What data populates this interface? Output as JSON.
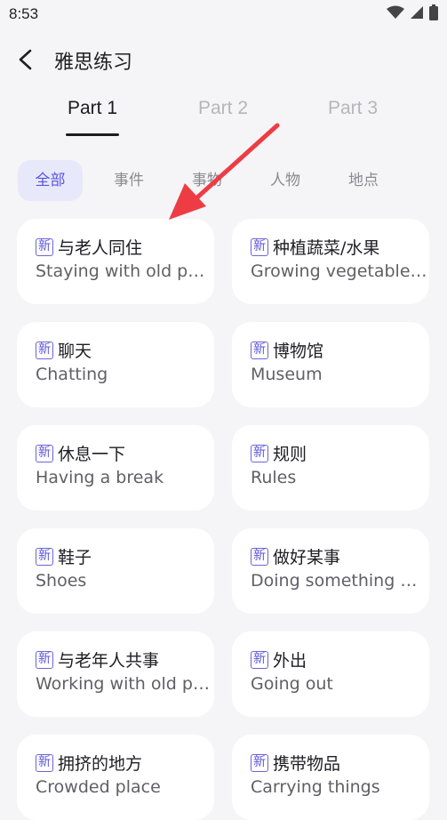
{
  "status_bar": {
    "time": "8:53"
  },
  "header": {
    "title": "雅思练习"
  },
  "tabs": [
    {
      "label": "Part 1",
      "active": true
    },
    {
      "label": "Part 2",
      "active": false
    },
    {
      "label": "Part 3",
      "active": false
    }
  ],
  "filters": [
    {
      "label": "全部",
      "active": true
    },
    {
      "label": "事件",
      "active": false
    },
    {
      "label": "事物",
      "active": false
    },
    {
      "label": "人物",
      "active": false
    },
    {
      "label": "地点",
      "active": false
    }
  ],
  "badge_label": "新",
  "topics": [
    {
      "title": "与老人同住",
      "subtitle": "Staying with old people"
    },
    {
      "title": "种植蔬菜/水果",
      "subtitle": "Growing vegetables/fruits"
    },
    {
      "title": "聊天",
      "subtitle": "Chatting"
    },
    {
      "title": "博物馆",
      "subtitle": "Museum"
    },
    {
      "title": "休息一下",
      "subtitle": "Having a break"
    },
    {
      "title": "规则",
      "subtitle": "Rules"
    },
    {
      "title": "鞋子",
      "subtitle": "Shoes"
    },
    {
      "title": "做好某事",
      "subtitle": "Doing something well"
    },
    {
      "title": "与老年人共事",
      "subtitle": "Working with old people"
    },
    {
      "title": "外出",
      "subtitle": "Going out"
    },
    {
      "title": "拥挤的地方",
      "subtitle": "Crowded place"
    },
    {
      "title": "携带物品",
      "subtitle": "Carrying things"
    }
  ],
  "colors": {
    "accent": "#5a55e0",
    "arrow": "#ee3c45",
    "background": "#f5f5f7"
  }
}
